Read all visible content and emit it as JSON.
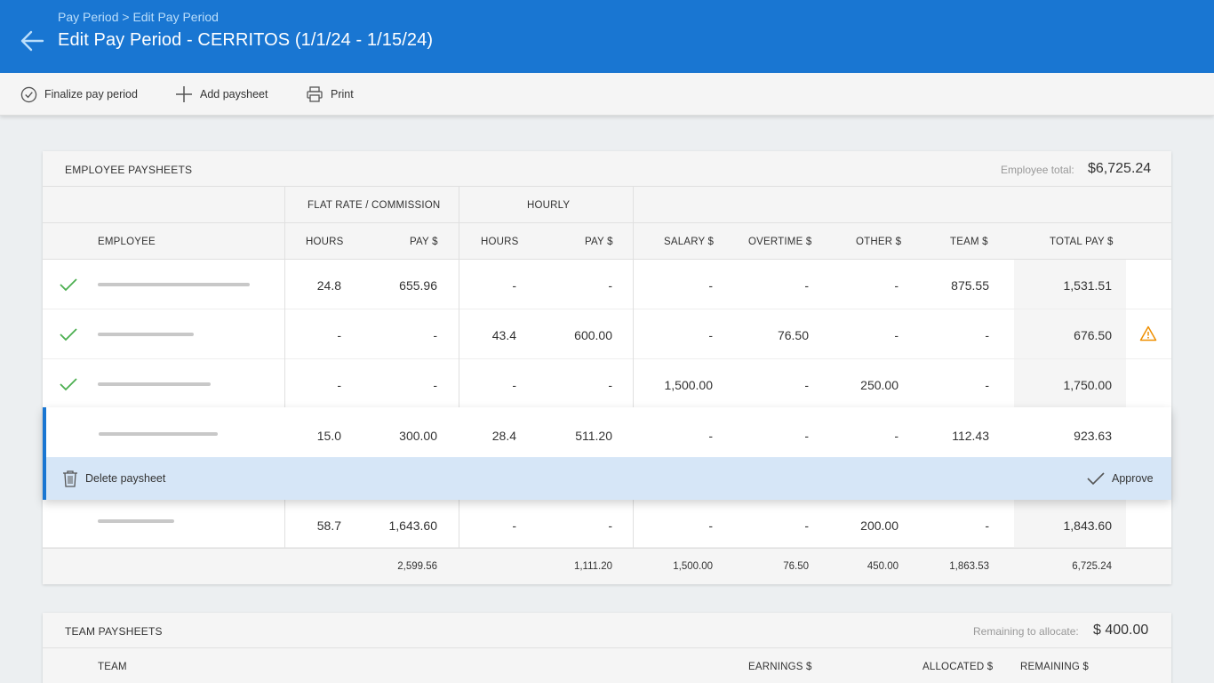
{
  "header": {
    "breadcrumb": "Pay Period > Edit Pay Period",
    "title": "Edit Pay Period - CERRITOS (1/1/24 - 1/15/24)"
  },
  "toolbar": {
    "finalize": "Finalize pay period",
    "add": "Add paysheet",
    "print": "Print"
  },
  "employee": {
    "title": "EMPLOYEE PAYSHEETS",
    "total_label": "Employee total:",
    "total_value": "$6,725.24",
    "groups": {
      "flat": "FLAT RATE / COMMISSION",
      "hourly": "HOURLY"
    },
    "columns": {
      "employee": "EMPLOYEE",
      "flat_hours": "HOURS",
      "flat_pay": "PAY $",
      "hourly_hours": "HOURS",
      "hourly_pay": "PAY $",
      "salary": "SALARY $",
      "overtime": "OVERTIME $",
      "other": "OTHER $",
      "team": "TEAM $",
      "total": "TOTAL PAY $"
    },
    "rows": [
      {
        "approved": true,
        "flat_hours": "24.8",
        "flat_pay": "655.96",
        "hourly_hours": "-",
        "hourly_pay": "-",
        "salary": "-",
        "overtime": "-",
        "other": "-",
        "team": "875.55",
        "total": "1,531.51",
        "warning": false
      },
      {
        "approved": true,
        "flat_hours": "-",
        "flat_pay": "-",
        "hourly_hours": "43.4",
        "hourly_pay": "600.00",
        "salary": "-",
        "overtime": "76.50",
        "other": "-",
        "team": "-",
        "total": "676.50",
        "warning": true
      },
      {
        "approved": true,
        "flat_hours": "-",
        "flat_pay": "-",
        "hourly_hours": "-",
        "hourly_pay": "-",
        "salary": "1,500.00",
        "overtime": "-",
        "other": "250.00",
        "team": "-",
        "total": "1,750.00",
        "warning": false
      },
      {
        "approved": false,
        "flat_hours": "15.0",
        "flat_pay": "300.00",
        "hourly_hours": "28.4",
        "hourly_pay": "511.20",
        "salary": "-",
        "overtime": "-",
        "other": "-",
        "team": "112.43",
        "total": "923.63",
        "warning": false
      },
      {
        "approved": false,
        "flat_hours": "58.7",
        "flat_pay": "1,643.60",
        "hourly_hours": "-",
        "hourly_pay": "-",
        "salary": "-",
        "overtime": "-",
        "other": "200.00",
        "team": "-",
        "total": "1,843.60",
        "warning": false
      }
    ],
    "selected_actions": {
      "delete": "Delete paysheet",
      "approve": "Approve"
    },
    "totals": {
      "flat_pay": "2,599.56",
      "hourly_pay": "1,111.20",
      "salary": "1,500.00",
      "overtime": "76.50",
      "other": "450.00",
      "team": "1,863.53",
      "total": "6,725.24"
    }
  },
  "team": {
    "title": "TEAM PAYSHEETS",
    "remaining_label": "Remaining to allocate:",
    "remaining_value": "$ 400.00",
    "columns": {
      "team": "TEAM",
      "earnings": "EARNINGS $",
      "allocated": "ALLOCATED $",
      "remaining": "REMAINING $"
    }
  },
  "colors": {
    "primary": "#1976d2",
    "approved": "#4caf50",
    "warning": "#ef8f00",
    "selected_bar": "#d6e6f7"
  }
}
